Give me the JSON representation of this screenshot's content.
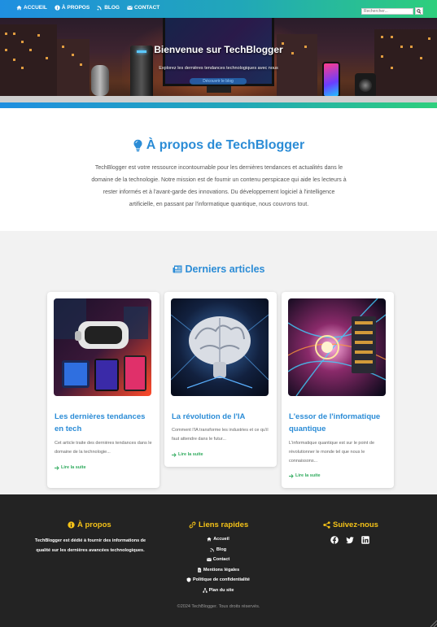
{
  "nav": {
    "items": [
      {
        "label": "ACCUEIL",
        "icon": "home-icon"
      },
      {
        "label": "À PROPOS",
        "icon": "info-icon"
      },
      {
        "label": "BLOG",
        "icon": "blog-icon"
      },
      {
        "label": "CONTACT",
        "icon": "envelope-icon"
      }
    ],
    "search_placeholder": "Rechercher...",
    "search_icon": "search-icon"
  },
  "hero": {
    "title": "Bienvenue sur TechBlogger",
    "subtitle": "Explorez les dernières tendances technologiques avec nous",
    "button_label": "Découvrir le blog"
  },
  "about": {
    "icon": "lightbulb-icon",
    "title": "À propos de TechBlogger",
    "text": "TechBlogger est votre ressource incontournable pour les dernières tendances et actualités dans le domaine de la technologie. Notre mission est de fournir un contenu perspicace qui aide les lecteurs à rester informés et à l'avant-garde des innovations. Du développement logiciel à l'intelligence artificielle, en passant par l'informatique quantique, nous couvrons tout."
  },
  "articles": {
    "icon": "newspaper-icon",
    "title": "Derniers articles",
    "read_more": "Lire la suite",
    "items": [
      {
        "title": "Les dernières tendances en tech",
        "excerpt": "Cet article traite des dernières tendances dans le domaine de la technologie..."
      },
      {
        "title": "La révolution de l'IA",
        "excerpt": "Comment l'IA transforme les industries et ce qu'il faut attendre dans le futur..."
      },
      {
        "title": "L'essor de l'informatique quantique",
        "excerpt": "L'informatique quantique est sur le point de révolutionner le monde tel que nous le connaissons..."
      }
    ]
  },
  "footer": {
    "about_title": "À propos",
    "about_text": "TechBlogger est dédié à fournir des informations de qualité sur les dernières avancées technologiques.",
    "links_title": "Liens rapides",
    "links": [
      {
        "label": "Accueil",
        "icon": "home-icon"
      },
      {
        "label": "Blog",
        "icon": "blog-icon"
      },
      {
        "label": "Contact",
        "icon": "envelope-icon"
      },
      {
        "label": "Mentions légales",
        "icon": "file-icon"
      },
      {
        "label": "Politique de confidentialité",
        "icon": "shield-icon"
      },
      {
        "label": "Plan du site",
        "icon": "sitemap-icon"
      }
    ],
    "social_title": "Suivez-nous",
    "social": [
      "facebook-icon",
      "twitter-icon",
      "linkedin-icon"
    ],
    "copyright": "©2024 TechBlogger. Tous droits réservés."
  },
  "colors": {
    "accent_blue": "#2b8cd6",
    "accent_green": "#2eaa5c",
    "footer_heading": "#f4c218",
    "footer_bg": "#232323"
  }
}
